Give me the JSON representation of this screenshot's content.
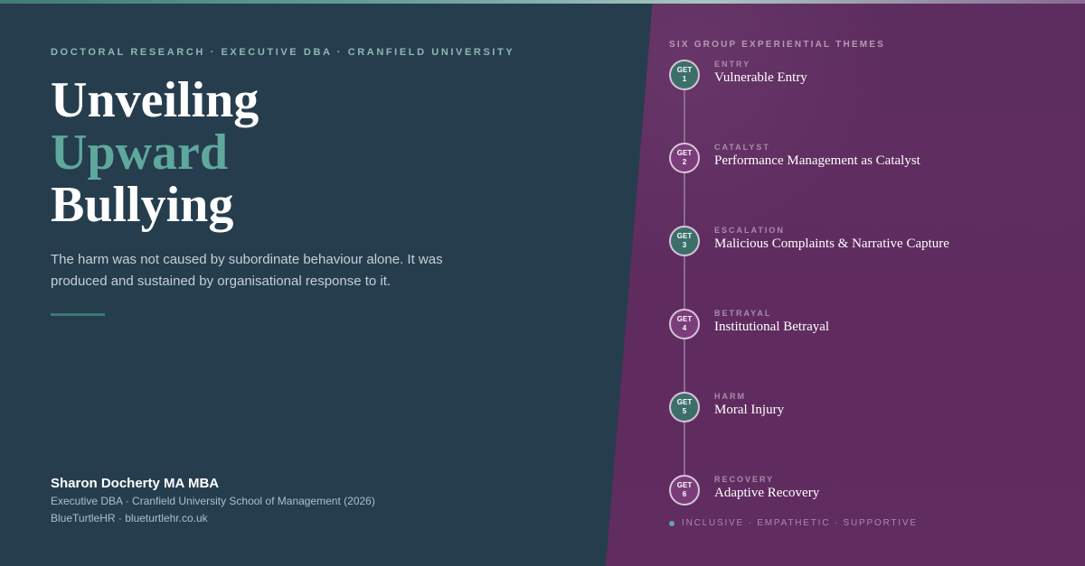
{
  "header": {
    "eyebrow": "DOCTORAL RESEARCH · EXECUTIVE DBA · CRANFIELD UNIVERSITY",
    "title_line1": "Unveiling",
    "title_line2": "Upward",
    "title_line3": "Bullying",
    "subtitle": "The harm was not caused by subordinate behaviour alone. It was produced and sustained by organisational response to it."
  },
  "author": {
    "name": "Sharon Docherty MA MBA",
    "line1": "Executive DBA · Cranfield University School of Management (2026)",
    "line2": "BlueTurtleHR · blueturtlehr.co.uk"
  },
  "themes": {
    "heading": "SIX GROUP EXPERIENTIAL THEMES",
    "items": [
      {
        "badge_top": "GET",
        "badge_num": "1",
        "label": "ENTRY",
        "title": "Vulnerable Entry",
        "color": "#3c6f6a"
      },
      {
        "badge_top": "GET",
        "badge_num": "2",
        "label": "CATALYST",
        "title": "Performance Management as Catalyst",
        "color": "#7a3d7a"
      },
      {
        "badge_top": "GET",
        "badge_num": "3",
        "label": "ESCALATION",
        "title": "Malicious Complaints & Narrative Capture",
        "color": "#3c6f6a"
      },
      {
        "badge_top": "GET",
        "badge_num": "4",
        "label": "BETRAYAL",
        "title": "Institutional Betrayal",
        "color": "#7a3d7a"
      },
      {
        "badge_top": "GET",
        "badge_num": "5",
        "label": "HARM",
        "title": "Moral Injury",
        "color": "#3c6f6a"
      },
      {
        "badge_top": "GET",
        "badge_num": "6",
        "label": "RECOVERY",
        "title": "Adaptive Recovery",
        "color": "#7a3d7a"
      }
    ]
  },
  "tagline": "INCLUSIVE · EMPATHETIC · SUPPORTIVE",
  "colors": {
    "left_bg": "#263d4e",
    "right_bg": "#5e2d5f",
    "accent_teal": "#5fa89d"
  }
}
